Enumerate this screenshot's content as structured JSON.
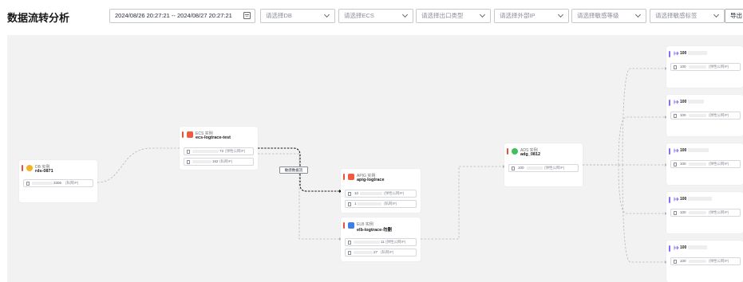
{
  "page_title": "数据流转分析",
  "filters": {
    "date_range": "2024/08/26 20:27:21 -- 2024/08/27 20:27:21",
    "db_placeholder": "请选择DB",
    "ecs_placeholder": "请选择ECS",
    "egress_placeholder": "请选择出口类型",
    "external_ip_placeholder": "请选择外部IP",
    "sensitivity_level_placeholder": "请选择敏感等级",
    "sensitivity_tag_placeholder": "请选择敏感标签",
    "export_label": "导出"
  },
  "edge_label": "敏感数据流",
  "nodes": {
    "db": {
      "type": "DB 实例",
      "name": "rds-0871",
      "ips": [
        {
          "num": "3306",
          "label": "(私网IP)"
        }
      ]
    },
    "ecs": {
      "type": "ECS 实例",
      "name": "ecs-logtrace-test",
      "ips": [
        {
          "num": "73",
          "label": "(弹性公网IP)"
        },
        {
          "num": "162",
          "label": "(私网IP)"
        }
      ]
    },
    "apig": {
      "type": "APIG 实例",
      "name": "apig-logtrace",
      "ips": [
        {
          "num": "10",
          "label": "(弹性公网IP)"
        },
        {
          "num": "1",
          "label": "(私网IP)"
        }
      ]
    },
    "elb": {
      "type": "ELB 实例",
      "name": "elb-logtrace-勿删",
      "ips": [
        {
          "num": "11",
          "label": "(弹性公网IP)"
        },
        {
          "num": "27",
          "label": "(私网IP)"
        }
      ]
    },
    "ads": {
      "type": "ADS 实例",
      "name": "adg_0812",
      "ips": [
        {
          "num": "100",
          "label": "(弹性公网IP)"
        }
      ]
    }
  },
  "destinations": [
    {
      "head": "100",
      "num": "100",
      "label": "(弹性公网IP)"
    },
    {
      "head": "100",
      "num": "100",
      "label": "(弹性公网IP)"
    },
    {
      "head": "100",
      "num": "100",
      "label": "(弹性公网IP)"
    },
    {
      "head": "100",
      "num": "100",
      "label": "(弹性公网IP)"
    },
    {
      "head": "100",
      "num": "100",
      "label": "(弹性公网IP)"
    }
  ],
  "colors": {
    "accent_bar": "#e5533a",
    "dest_bar": "#8a6cf2",
    "db_icon": "#f5b324",
    "ecs_icon": "#ef5b3d",
    "apig_icon": "#ef5b3d",
    "elb_icon": "#3f7ee8",
    "ads_icon": "#3fbf5f",
    "canvas": "#f2f2f2"
  }
}
